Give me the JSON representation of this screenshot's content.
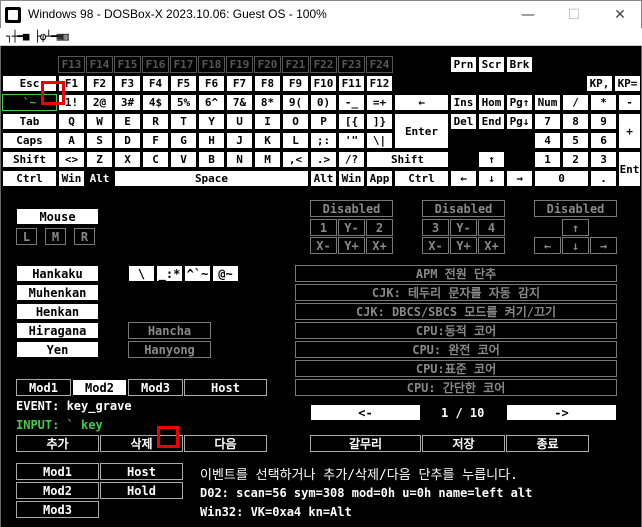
{
  "window": {
    "title": "Windows 98 - DOSBox-X 2023.10.06: Guest OS - 100%",
    "minimize": "—",
    "maximize": "☐",
    "close": "✕",
    "toolbar_icons": "┐┼━■ ├φ┴━▦▥"
  },
  "keyboard": {
    "fkeys_hi": [
      "F13",
      "F14",
      "F15",
      "F16",
      "F17",
      "F18",
      "F19",
      "F20",
      "F21",
      "F22",
      "F23",
      "F24"
    ],
    "row_f": [
      "Esc",
      "F1",
      "F2",
      "F3",
      "F4",
      "F5",
      "F6",
      "F7",
      "F8",
      "F9",
      "F10",
      "F11",
      "F12"
    ],
    "sys_keys": [
      "Prn",
      "Scr",
      "Brk"
    ],
    "kp_keys": [
      "KP,",
      "KP="
    ],
    "row_num": [
      "`~",
      "1!",
      "2@",
      "3#",
      "4$",
      "5%",
      "6^",
      "7&",
      "8*",
      "9(",
      "0)",
      "-_",
      "=+"
    ],
    "row_num_right": [
      "←",
      "Ins",
      "Hom",
      "Pg↑",
      "Num",
      "/",
      "*",
      "-"
    ],
    "row_q": [
      "Tab",
      "Q",
      "W",
      "E",
      "R",
      "T",
      "Y",
      "U",
      "I",
      "O",
      "P",
      "[{",
      "]}"
    ],
    "row_q_right": [
      "Del",
      "End",
      "Pg↓",
      "7",
      "8",
      "9",
      "+"
    ],
    "enter": "Enter",
    "row_a": [
      "Caps",
      "A",
      "S",
      "D",
      "F",
      "G",
      "H",
      "J",
      "K",
      "L",
      ";:",
      "'\"",
      "\\|"
    ],
    "row_a_right": [
      "4",
      "5",
      "6"
    ],
    "row_z": [
      "Shift",
      "<>",
      "Z",
      "X",
      "C",
      "V",
      "B",
      "N",
      "M",
      ",<",
      ".>",
      "/?",
      "Shift"
    ],
    "row_z_right": [
      "↑",
      "1",
      "2",
      "3",
      "Ent"
    ],
    "row_ctrl": [
      "Ctrl",
      "Win",
      "Alt",
      "Space",
      "Alt",
      "Win",
      "App",
      "Ctrl"
    ],
    "row_ctrl_right": [
      "←",
      "↓",
      "→",
      "0",
      "."
    ]
  },
  "joysticks": [
    {
      "label": "Disabled",
      "b1": "1",
      "axis_y_minus": "Y-",
      "b2": "2",
      "x_minus": "X-",
      "axis_y_plus": "Y+",
      "x_plus": "X+"
    },
    {
      "label": "Disabled",
      "b1": "3",
      "axis_y_minus": "Y-",
      "b2": "4",
      "x_minus": "X-",
      "axis_y_plus": "Y+",
      "x_plus": "X+"
    },
    {
      "label": "Disabled",
      "up": "↑",
      "left": "←",
      "down": "↓",
      "right": "→"
    }
  ],
  "mouse": {
    "label": "Mouse",
    "buttons": [
      "L",
      "M",
      "R"
    ]
  },
  "jp_keys": [
    "Hankaku",
    "Muhenkan",
    "Henkan",
    "Hiragana",
    "Yen"
  ],
  "symbol_keys": [
    "\\",
    "_:*",
    "^`~",
    "@~"
  ],
  "hancha": "Hancha",
  "hanyong": "Hanyong",
  "options": [
    "APM 전원 단추",
    "CJK: 테두리 문자를 자동 감지",
    "CJK: DBCS/SBCS 모드를 켜기/끄기",
    "CPU:동적 코어",
    "CPU: 완전 코어",
    "CPU:표준 코어",
    "CPU: 간단한 코어"
  ],
  "mods": [
    "Mod1",
    "Mod2",
    "Mod3",
    "Host"
  ],
  "event_line": "EVENT: key_grave",
  "input_line": "INPUT: ` key",
  "pager": {
    "prev": "<-",
    "page": "1 / 10",
    "next": "->"
  },
  "actions": [
    "추가",
    "삭제",
    "다음",
    "갈무리",
    "저장",
    "종료"
  ],
  "bottom_mods": [
    "Mod1",
    "Host",
    "Mod2",
    "Hold",
    "Mod3"
  ],
  "hint": "이벤트를 선택하거나 추가/삭제/다음 단추를 누릅니다.",
  "d02_line": "D02: scan=56 sym=308 mod=0h u=0h name=left alt",
  "win32_line": "Win32: VK=0xa4 kn=Alt"
}
